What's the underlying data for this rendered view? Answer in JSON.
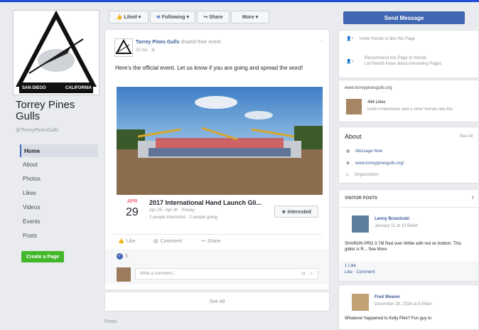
{
  "left": {
    "logo_text_top": "TORREY PINES GULLS",
    "logo_text_bottom_left": "SAN DIEGO",
    "logo_text_bottom_right": "CALIFORNIA",
    "page_name": "Torrey Pines Gulls",
    "handle": "@TorreyPinesGulls",
    "nav": [
      "Home",
      "About",
      "Photos",
      "Likes",
      "Videos",
      "Events",
      "Posts"
    ],
    "create_page": "Create a Page"
  },
  "actions": {
    "liked": "Liked ▾",
    "following": "Following ▾",
    "share": "Share",
    "more": "More ▾"
  },
  "post": {
    "author": "Torrey Pines Gulls",
    "action": "shared their event.",
    "time": "22 hrs",
    "text": "Here's the official event. Let us know if you are going and spread the word!",
    "event": {
      "month": "APR",
      "day": "29",
      "title": "2017 International Hand Launch Gli...",
      "dates": "Apr 29 - Apr 30 · Poway",
      "stats": "2 people interested · 2 people going",
      "interested": "★ Interested"
    },
    "like": "Like",
    "comment": "Comment",
    "share": "Share",
    "reactions": "5",
    "comment_placeholder": "Write a comment...",
    "see_all": "See All",
    "posts_heading": "Posts"
  },
  "right": {
    "send_message": "Send Message",
    "invite": "Invite friends to like this Page",
    "recommend_title": "Recommend this Page to friends",
    "recommend_sub": "Let friends know about interesting Pages",
    "url": "www.torreypinesgulls.org",
    "likes_count": "444 Likes",
    "likes_friends": "Keith Finkenbiner and 5 other friends like this",
    "about_title": "About",
    "about_see_all": "See All",
    "message_now": "Message Now",
    "website": "www.torreypinesgulls.org/",
    "organization": "Organization",
    "visitor_posts": "VISITOR POSTS",
    "vp1_name": "Lenny Brzezinski",
    "vp1_time": "January 11 at 10:58am",
    "vp1_text": "SHARON PRO 3.7M Red over White with red on bottom. This glider is R... See More",
    "vp1_likes": "1 Like",
    "vp1_actions": "Like · Comment",
    "vp2_name": "Fred Weaver",
    "vp2_time": "December 28, 2016 at 6:59am",
    "vp2_text": "Whatever happened to Kelly Pike? Fun guy to"
  }
}
